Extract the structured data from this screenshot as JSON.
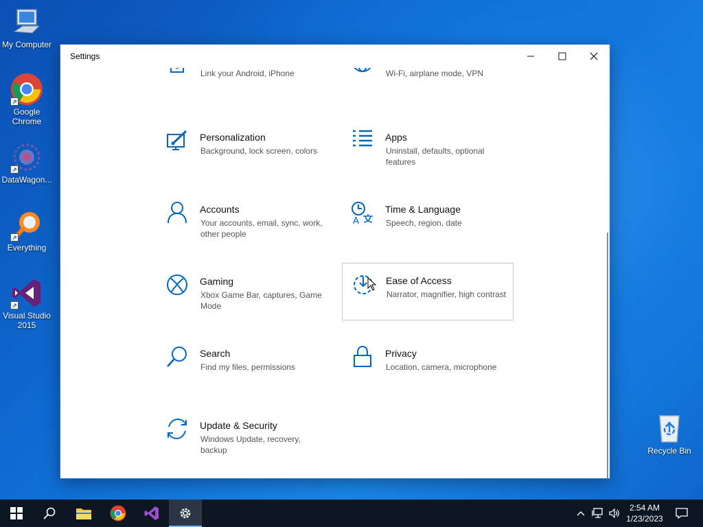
{
  "desktop": {
    "icons": [
      {
        "label": "My Computer"
      },
      {
        "label": "Google Chrome"
      },
      {
        "label": "DataWagon..."
      },
      {
        "label": "Everything"
      },
      {
        "label": "Visual Studio 2015"
      },
      {
        "label": "Recycle Bin"
      }
    ]
  },
  "window": {
    "title": "Settings",
    "controls": {
      "minimize": "minimize-icon",
      "maximize": "maximize-icon",
      "close": "close-icon"
    }
  },
  "tiles": [
    {
      "name": "",
      "desc": "Link your Android, iPhone",
      "icon": "phone-icon"
    },
    {
      "name": "",
      "desc": "Wi-Fi, airplane mode, VPN",
      "icon": "globe-icon"
    },
    {
      "name": "Personalization",
      "desc": "Background, lock screen, colors",
      "icon": "paintbrush-icon"
    },
    {
      "name": "Apps",
      "desc": "Uninstall, defaults, optional features",
      "icon": "apps-list-icon"
    },
    {
      "name": "Accounts",
      "desc": "Your accounts, email, sync, work, other people",
      "icon": "person-icon"
    },
    {
      "name": "Time & Language",
      "desc": "Speech, region, date",
      "icon": "time-language-icon"
    },
    {
      "name": "Gaming",
      "desc": "Xbox Game Bar, captures, Game Mode",
      "icon": "xbox-icon"
    },
    {
      "name": "Ease of Access",
      "desc": "Narrator, magnifier, high contrast",
      "icon": "ease-of-access-icon"
    },
    {
      "name": "Search",
      "desc": "Find my files, permissions",
      "icon": "search-icon"
    },
    {
      "name": "Privacy",
      "desc": "Location, camera, microphone",
      "icon": "lock-icon"
    },
    {
      "name": "Update & Security",
      "desc": "Windows Update, recovery, backup",
      "icon": "update-icon"
    }
  ],
  "taskbar": {
    "time": "2:54 AM",
    "date": "1/23/2023"
  },
  "colors": {
    "accent": "#0067c0",
    "taskbar": "#0c1522"
  }
}
